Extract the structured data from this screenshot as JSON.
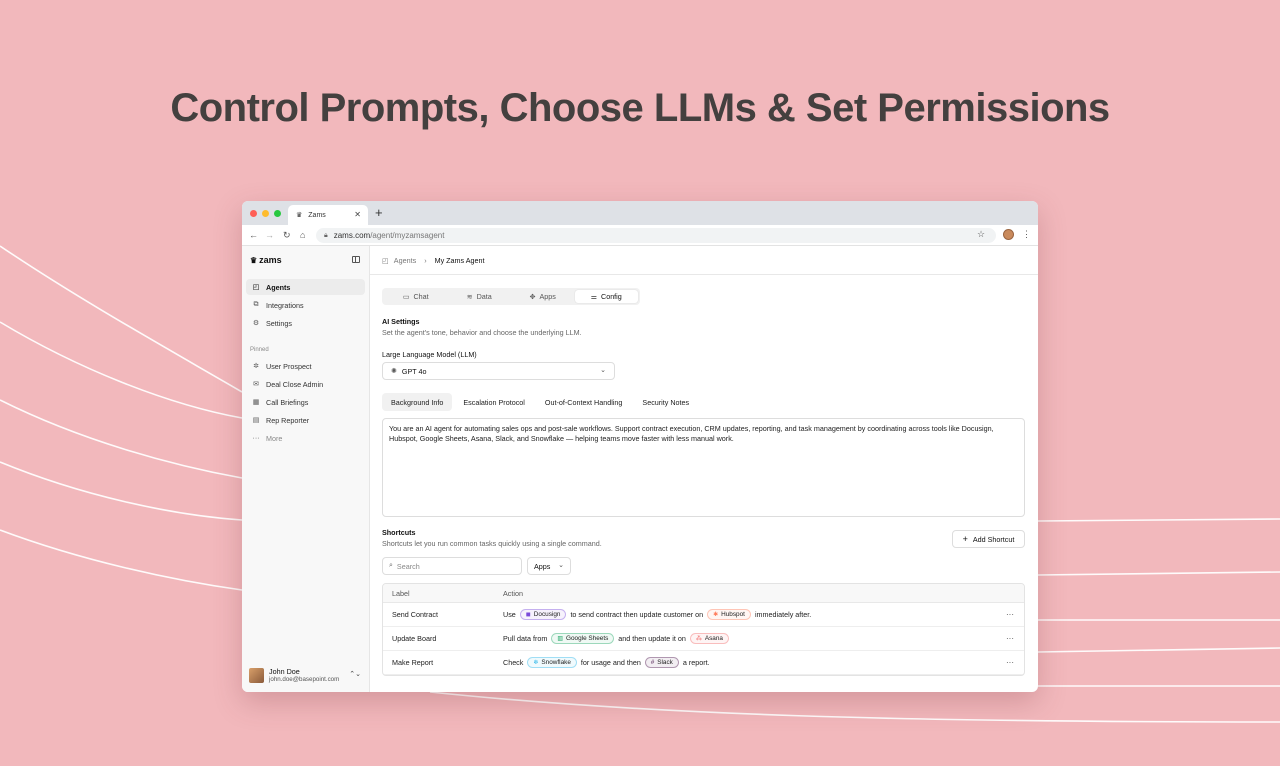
{
  "hero_title": "Control Prompts, Choose LLMs & Set Permissions",
  "browser": {
    "tab_title": "Zams",
    "url_domain": "zams.com",
    "url_path": "/agent/myzamsagent",
    "traffic_colors": [
      "#ff5f57",
      "#febc2e",
      "#28c840"
    ]
  },
  "sidebar": {
    "brand": "zams",
    "items": [
      {
        "label": "Agents",
        "icon": "bot-icon"
      },
      {
        "label": "Integrations",
        "icon": "integrations-icon"
      },
      {
        "label": "Settings",
        "icon": "gear-icon"
      }
    ],
    "pinned_label": "Pinned",
    "pinned": [
      {
        "label": "User Prospect",
        "icon": "puzzle-icon"
      },
      {
        "label": "Deal Close Admin",
        "icon": "handshake-icon"
      },
      {
        "label": "Call Briefings",
        "icon": "calendar-icon"
      },
      {
        "label": "Rep Reporter",
        "icon": "report-icon"
      }
    ],
    "more_label": "More",
    "user": {
      "name": "John Doe",
      "email": "john.doe@basepoint.com"
    }
  },
  "breadcrumb": {
    "root": "Agents",
    "current": "My Zams Agent"
  },
  "tabs": [
    "Chat",
    "Data",
    "Apps",
    "Config"
  ],
  "active_tab": "Config",
  "ai_settings": {
    "title": "AI Settings",
    "subtitle": "Set the agent's tone, behavior and choose the underlying LLM.",
    "llm_label": "Large Language Model (LLM)",
    "llm_value": "GPT 4o"
  },
  "prompt_tabs": [
    "Background Info",
    "Escalation Protocol",
    "Out-of-Context Handling",
    "Security Notes"
  ],
  "prompt_text": "You are an AI agent for automating sales ops and post-sale workflows. Support contract execution, CRM updates, reporting, and task management by coordinating across tools like Docusign, Hubspot, Google Sheets, Asana, Slack, and Snowflake — helping teams move faster with less manual work.",
  "shortcuts": {
    "title": "Shortcuts",
    "subtitle": "Shortcuts let you run common tasks quickly using a single command.",
    "add_label": "Add Shortcut",
    "search_placeholder": "Search",
    "filter_value": "Apps",
    "col_label": "Label",
    "col_action": "Action",
    "rows": [
      {
        "label": "Send Contract",
        "t1": "Use",
        "app1": "Docusign",
        "t2": "to send contract then update customer on",
        "app2": "Hubspot",
        "t3": "immediately after."
      },
      {
        "label": "Update Board",
        "t1": "Pull data from",
        "app1": "Google Sheets",
        "t2": "and then update it on",
        "app2": "Asana",
        "t3": ""
      },
      {
        "label": "Make Report",
        "t1": "Check",
        "app1": "Snowflake",
        "t2": "for usage and then",
        "app2": "Slack",
        "t3": "a report."
      }
    ]
  },
  "app_colors": {
    "Docusign": "#7b4ad9",
    "Hubspot": "#ff7a59",
    "Google Sheets": "#1fa463",
    "Asana": "#f06a6a",
    "Snowflake": "#29b5e8",
    "Slack": "#4a154b"
  }
}
